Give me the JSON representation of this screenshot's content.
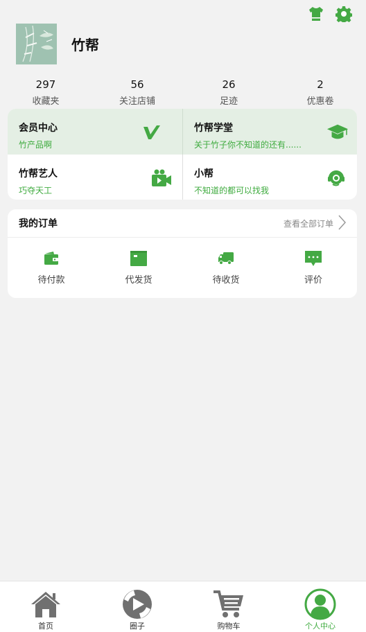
{
  "header": {
    "icons": [
      "shirt-icon",
      "gear-icon"
    ],
    "username": "竹帮"
  },
  "stats": [
    {
      "value": "297",
      "label": "收藏夹"
    },
    {
      "value": "56",
      "label": "关注店铺"
    },
    {
      "value": "26",
      "label": "足迹"
    },
    {
      "value": "2",
      "label": "优惠卷"
    }
  ],
  "services": [
    {
      "title": "会员中心",
      "subtitle": "竹产品啊",
      "icon": "vip-v-icon"
    },
    {
      "title": "竹帮学堂",
      "subtitle": "关于竹子你不知道的还有......",
      "icon": "graduation-cap-icon"
    },
    {
      "title": "竹帮艺人",
      "subtitle": "巧夺天工",
      "icon": "video-camera-icon"
    },
    {
      "title": "小帮",
      "subtitle": "不知道的都可以找我",
      "icon": "headset-icon"
    }
  ],
  "orders": {
    "title": "我的订单",
    "view_all": "查看全部订单",
    "items": [
      {
        "label": "待付款",
        "icon": "wallet-icon"
      },
      {
        "label": "代发货",
        "icon": "box-icon"
      },
      {
        "label": "待收货",
        "icon": "truck-icon"
      },
      {
        "label": "评价",
        "icon": "comment-icon"
      }
    ]
  },
  "tabs": [
    {
      "label": "首页",
      "icon": "home-icon"
    },
    {
      "label": "圈子",
      "icon": "circle-play-icon"
    },
    {
      "label": "购物车",
      "icon": "cart-icon"
    },
    {
      "label": "个人中心",
      "icon": "user-icon",
      "active": true
    }
  ],
  "colors": {
    "accent": "#3fab3f",
    "icon_green": "#44a944",
    "icon_gray": "#707070"
  }
}
